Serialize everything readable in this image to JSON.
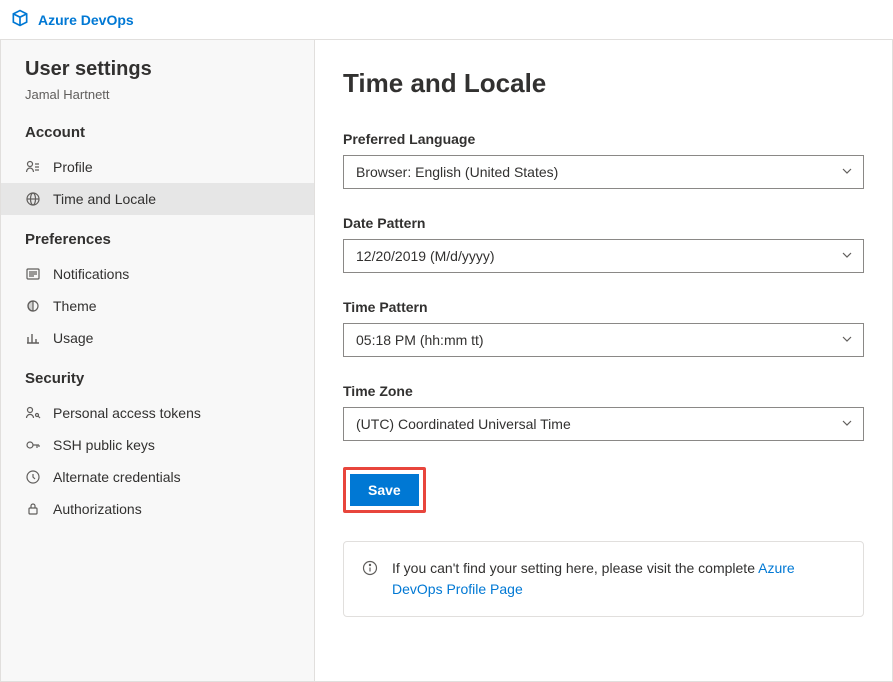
{
  "brand": "Azure DevOps",
  "sidebar": {
    "title": "User settings",
    "subtitle": "Jamal Hartnett",
    "sections": [
      {
        "title": "Account",
        "items": [
          {
            "label": "Profile"
          },
          {
            "label": "Time and Locale"
          }
        ]
      },
      {
        "title": "Preferences",
        "items": [
          {
            "label": "Notifications"
          },
          {
            "label": "Theme"
          },
          {
            "label": "Usage"
          }
        ]
      },
      {
        "title": "Security",
        "items": [
          {
            "label": "Personal access tokens"
          },
          {
            "label": "SSH public keys"
          },
          {
            "label": "Alternate credentials"
          },
          {
            "label": "Authorizations"
          }
        ]
      }
    ]
  },
  "main": {
    "title": "Time and Locale",
    "fields": {
      "language": {
        "label": "Preferred Language",
        "value": "Browser: English (United States)"
      },
      "datePattern": {
        "label": "Date Pattern",
        "value": "12/20/2019 (M/d/yyyy)"
      },
      "timePattern": {
        "label": "Time Pattern",
        "value": "05:18 PM (hh:mm tt)"
      },
      "timeZone": {
        "label": "Time Zone",
        "value": "(UTC) Coordinated Universal Time"
      }
    },
    "saveLabel": "Save",
    "callout": {
      "text": "If you can't find your setting here, please visit the complete ",
      "linkText": "Azure DevOps Profile Page"
    }
  }
}
